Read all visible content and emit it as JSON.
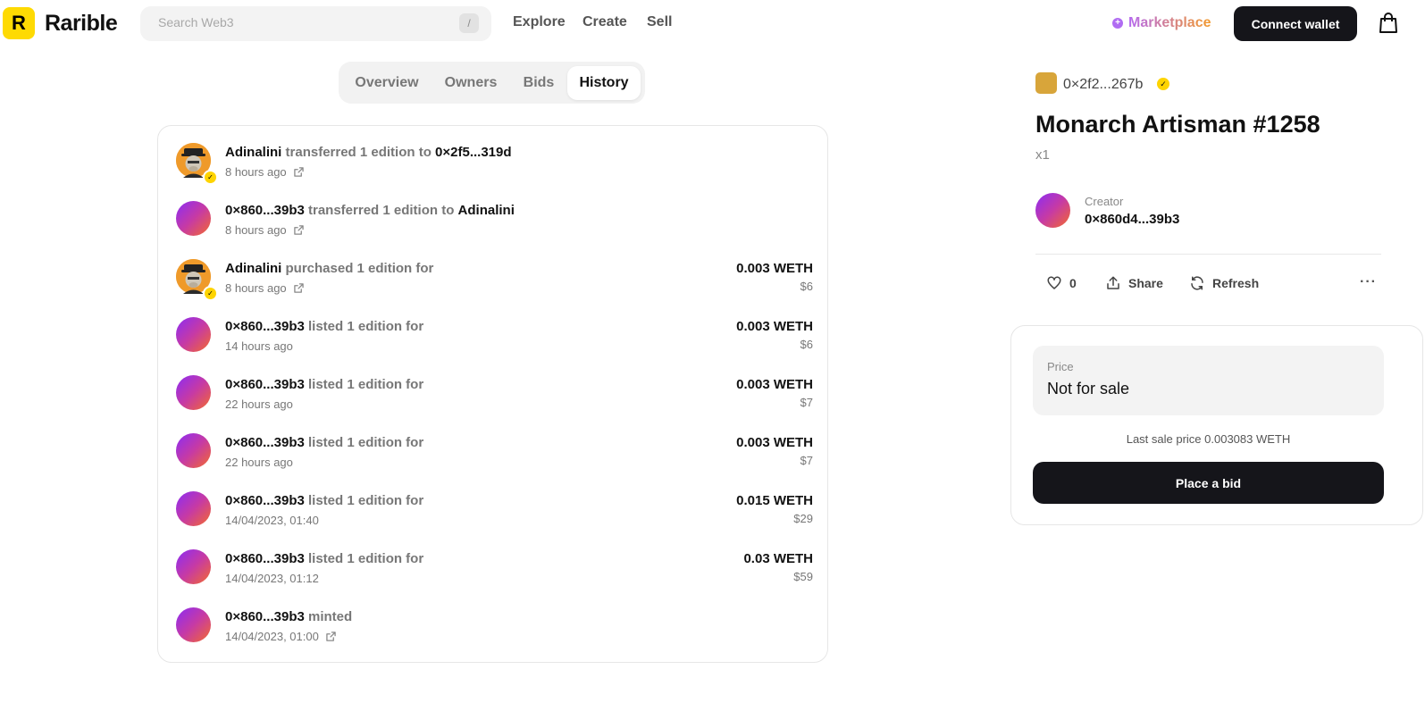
{
  "header": {
    "logo_letter": "R",
    "brand": "Rarible",
    "search_placeholder": "Search Web3",
    "search_shortcut": "/",
    "nav": [
      "Explore",
      "Create",
      "Sell"
    ],
    "marketplace": "Marketplace",
    "connect": "Connect wallet"
  },
  "tabs": [
    "Overview",
    "Owners",
    "Bids",
    "History"
  ],
  "active_tab": "History",
  "history": [
    {
      "actor": "Adinalini",
      "verb": "transferred 1 edition to",
      "target": "0×2f5...319d",
      "time": "8 hours ago",
      "link": true,
      "avatar": "ape",
      "price": "",
      "usd": ""
    },
    {
      "actor": "0×860...39b3",
      "verb": "transferred 1 edition to",
      "target": "Adinalini",
      "time": "8 hours ago",
      "link": true,
      "avatar": "gradient",
      "price": "",
      "usd": ""
    },
    {
      "actor": "Adinalini",
      "verb": "purchased 1 edition for",
      "target": "",
      "time": "8 hours ago",
      "link": true,
      "avatar": "ape",
      "price": "0.003 WETH",
      "usd": "$6"
    },
    {
      "actor": "0×860...39b3",
      "verb": "listed 1 edition for",
      "target": "",
      "time": "14 hours ago",
      "link": false,
      "avatar": "gradient",
      "price": "0.003 WETH",
      "usd": "$6"
    },
    {
      "actor": "0×860...39b3",
      "verb": "listed 1 edition for",
      "target": "",
      "time": "22 hours ago",
      "link": false,
      "avatar": "gradient",
      "price": "0.003 WETH",
      "usd": "$7"
    },
    {
      "actor": "0×860...39b3",
      "verb": "listed 1 edition for",
      "target": "",
      "time": "22 hours ago",
      "link": false,
      "avatar": "gradient",
      "price": "0.003 WETH",
      "usd": "$7"
    },
    {
      "actor": "0×860...39b3",
      "verb": "listed 1 edition for",
      "target": "",
      "time": "14/04/2023, 01:40",
      "link": false,
      "avatar": "gradient",
      "price": "0.015 WETH",
      "usd": "$29"
    },
    {
      "actor": "0×860...39b3",
      "verb": "listed 1 edition for",
      "target": "",
      "time": "14/04/2023, 01:12",
      "link": false,
      "avatar": "gradient",
      "price": "0.03 WETH",
      "usd": "$59"
    },
    {
      "actor": "0×860...39b3",
      "verb": "minted",
      "target": "",
      "time": "14/04/2023, 01:00",
      "link": true,
      "avatar": "gradient",
      "price": "",
      "usd": ""
    }
  ],
  "item": {
    "owner": "0×2f2...267b",
    "title": "Monarch Artisman #1258",
    "quantity": "x1",
    "creator_label": "Creator",
    "creator": "0×860d4...39b3",
    "likes": "0",
    "share": "Share",
    "refresh": "Refresh",
    "more": "···"
  },
  "sale": {
    "price_label": "Price",
    "price_value": "Not for sale",
    "last_sale": "Last sale price 0.003083 WETH",
    "bid_button": "Place a bid"
  },
  "colors": {
    "logo_yellow": "#feda03",
    "dark_button": "#15151a",
    "verified_badge": "#fed400",
    "avatar_gradient_start": "#8b2cf5",
    "avatar_gradient_end": "#f46a2c"
  }
}
